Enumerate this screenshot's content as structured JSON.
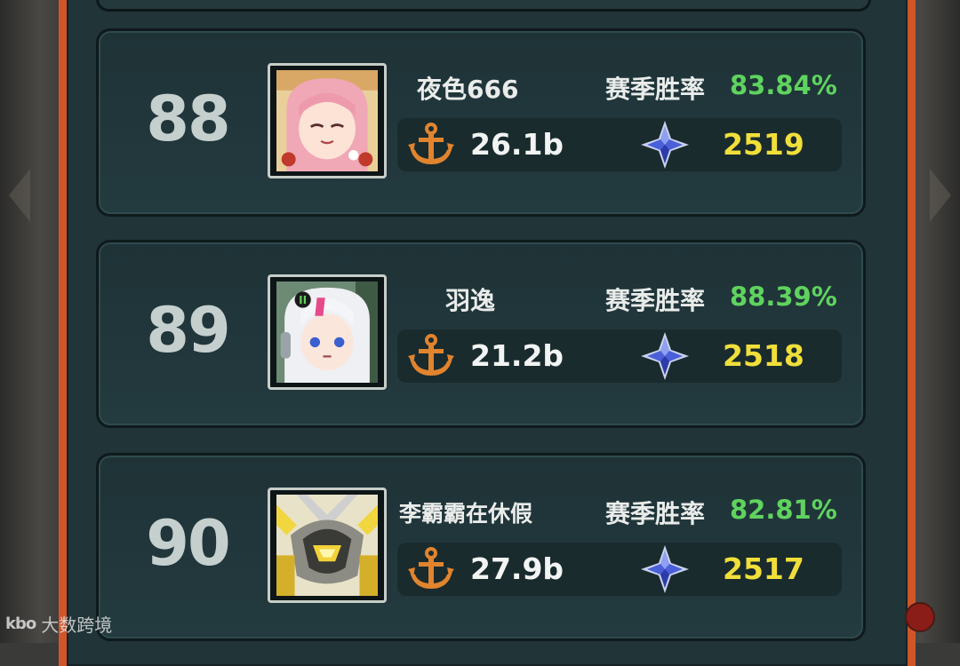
{
  "win_rate_label": "赛季胜率",
  "entries": [
    {
      "rank": "88",
      "name": "夜色666",
      "win_rate": "83.84%",
      "power": "26.1b",
      "score": "2519",
      "avatar": "pink-hair-avatar"
    },
    {
      "rank": "89",
      "name": "羽逸",
      "win_rate": "88.39%",
      "power": "21.2b",
      "score": "2518",
      "avatar": "white-hair-avatar"
    },
    {
      "rank": "90",
      "name": "李霸霸在休假",
      "win_rate": "82.81%",
      "power": "27.9b",
      "score": "2517",
      "avatar": "mech-armor-avatar"
    }
  ],
  "watermark": {
    "logo": "kbo",
    "text": "大数跨境"
  },
  "colors": {
    "accent_frame": "#d0562a",
    "win_rate": "#5fd35e",
    "score": "#f0df3a",
    "anchor": "#e0842e",
    "gem": "#4a5fd8"
  }
}
